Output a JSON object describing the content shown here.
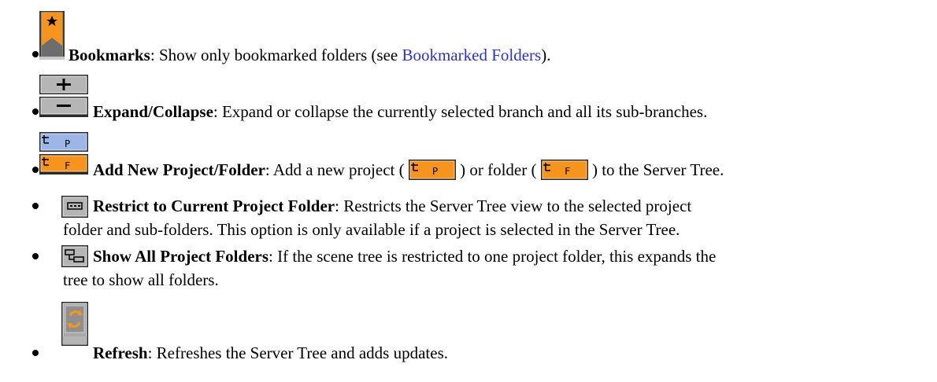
{
  "items": [
    {
      "icon": "bookmark-icon",
      "term": "Bookmarks",
      "text_before_link": ": Show only bookmarked folders (see ",
      "link": "Bookmarked Folders",
      "text_after_link": ")."
    },
    {
      "icon": "expand-collapse-icon",
      "term": "Expand/Collapse",
      "text": ": Expand or collapse the currently selected branch and all its sub-branches."
    },
    {
      "icon": "add-project-folder-icon",
      "term": "Add New Project/Folder",
      "text_a": ": Add a new project (",
      "text_b": ") or folder (",
      "text_c": ") to the Server Tree."
    },
    {
      "icon": "restrict-folder-icon",
      "term": "Restrict to Current Project Folder",
      "text": ": Restricts the Server Tree view to the selected project",
      "text_line2": "folder and sub-folders. This option is only available if a project is selected in the Server Tree."
    },
    {
      "icon": "show-all-folders-icon",
      "term": "Show All Project Folders",
      "text": ": If the scene tree is restricted to one project folder, this expands the",
      "text_line2": "tree to show all folders."
    },
    {
      "icon": "refresh-icon",
      "term": "Refresh",
      "text": ": Refreshes the Server Tree and adds updates."
    }
  ],
  "colors": {
    "orange": "#f7941d",
    "blue_button": "#9cb6e8",
    "gray_button": "#b0b0b0",
    "link": "#2a32d6"
  }
}
